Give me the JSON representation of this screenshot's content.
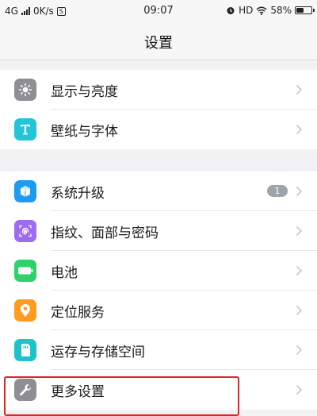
{
  "status_bar": {
    "network": "4G",
    "speed": "0K/s",
    "time": "09:07",
    "hd": "HD",
    "battery": "58%",
    "battery_level": 0.58
  },
  "header": {
    "title": "设置"
  },
  "groups": [
    {
      "items": [
        {
          "label": "显示与亮度",
          "icon": "brightness-icon",
          "icon_color": "#8e8e93"
        },
        {
          "label": "壁纸与字体",
          "icon": "font-t-icon",
          "icon_color": "#22c4d8"
        }
      ]
    },
    {
      "items": [
        {
          "label": "系统升级",
          "icon": "system-update-icon",
          "icon_color": "#1e9bf0",
          "badge": "1"
        },
        {
          "label": "指纹、面部与密码",
          "icon": "fingerprint-icon",
          "icon_color": "#9d6cf0"
        },
        {
          "label": "电池",
          "icon": "battery-icon",
          "icon_color": "#2fd16a"
        },
        {
          "label": "定位服务",
          "icon": "location-icon",
          "icon_color": "#ff9b1f"
        },
        {
          "label": "运存与存储空间",
          "icon": "storage-icon",
          "icon_color": "#1fc2c9"
        },
        {
          "label": "更多设置",
          "icon": "wrench-icon",
          "icon_color": "#8e8e93"
        }
      ]
    }
  ],
  "colors": {
    "highlight": "#e02424",
    "badge": "#9ea3ad",
    "chevron": "#c7c7cc"
  }
}
